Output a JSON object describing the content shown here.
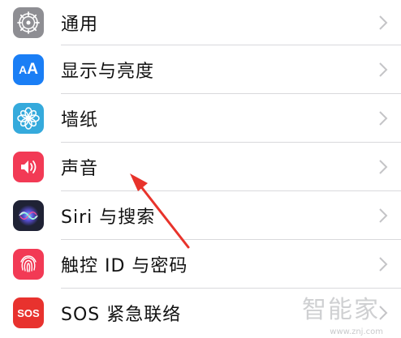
{
  "settings": {
    "items": [
      {
        "label": "通用",
        "icon": "gear-icon",
        "color": "#8e8e93"
      },
      {
        "label": "显示与亮度",
        "icon": "display-aa-icon",
        "color": "#1a7ef5"
      },
      {
        "label": "墙纸",
        "icon": "wallpaper-flower-icon",
        "color": "#35aadc"
      },
      {
        "label": "声音",
        "icon": "speaker-icon",
        "color": "#f23a55"
      },
      {
        "label": "Siri 与搜索",
        "icon": "siri-icon",
        "color": "#1f2235"
      },
      {
        "label": "触控 ID 与密码",
        "icon": "fingerprint-icon",
        "color": "#f23a55"
      },
      {
        "label": "SOS 紧急联络",
        "icon": "sos-icon",
        "color": "#e8322e",
        "icon_text": "SOS"
      }
    ]
  },
  "annotation": {
    "arrow_color": "#e8332b",
    "arrow_target": "声音"
  },
  "watermark": {
    "text": "智能家",
    "url": "www.znj.com"
  }
}
